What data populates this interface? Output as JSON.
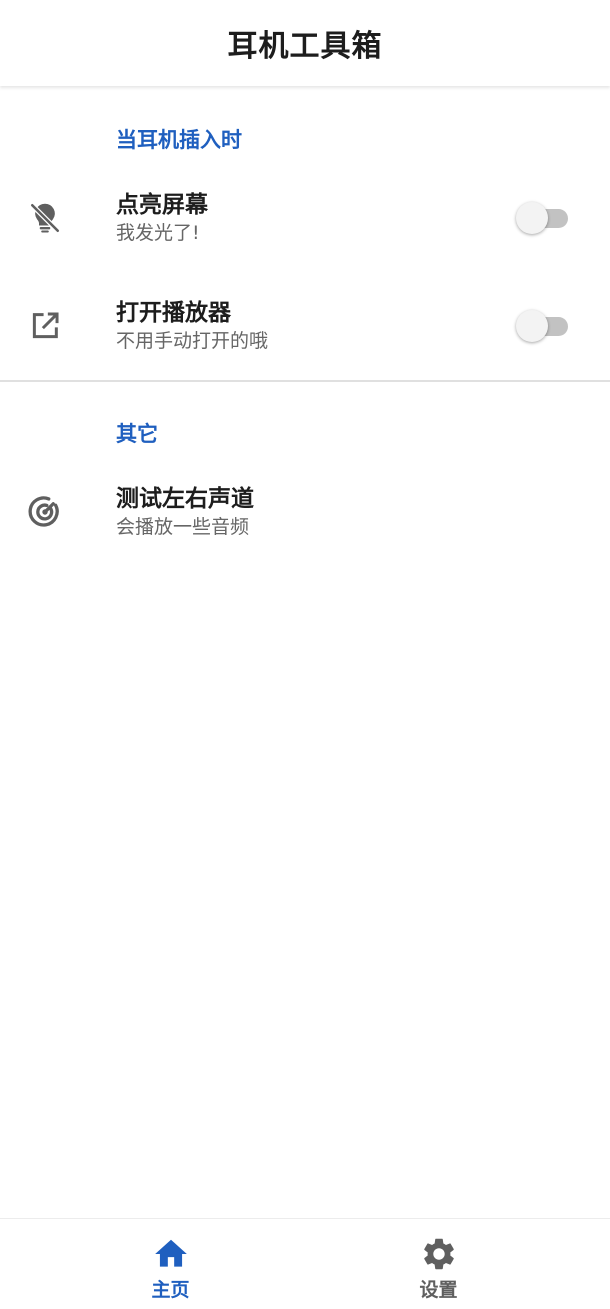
{
  "app": {
    "title": "耳机工具箱"
  },
  "colors": {
    "accent": "#1f5fbf",
    "title_text": "#1d1d1d",
    "subtitle_text": "#666666",
    "icon_gray": "#5f5f5f",
    "switch_track_off": "#c2c2c2",
    "switch_thumb_off": "#f3f3f3"
  },
  "sections": [
    {
      "header": "当耳机插入时",
      "items": [
        {
          "icon": "lightbulb-off-icon",
          "title": "点亮屏幕",
          "subtitle": "我发光了!",
          "switch_on": false
        },
        {
          "icon": "open-in-new-icon",
          "title": "打开播放器",
          "subtitle": "不用手动打开的哦",
          "switch_on": false
        }
      ]
    },
    {
      "header": "其它",
      "items": [
        {
          "icon": "radar-icon",
          "title": "测试左右声道",
          "subtitle": "会播放一些音频"
        }
      ]
    }
  ],
  "bottom_nav": {
    "items": [
      {
        "label": "主页",
        "icon": "home-icon",
        "active": true,
        "color": "#1f5fbf"
      },
      {
        "label": "设置",
        "icon": "gear-icon",
        "active": false,
        "color": "#5f5f5f"
      }
    ]
  }
}
